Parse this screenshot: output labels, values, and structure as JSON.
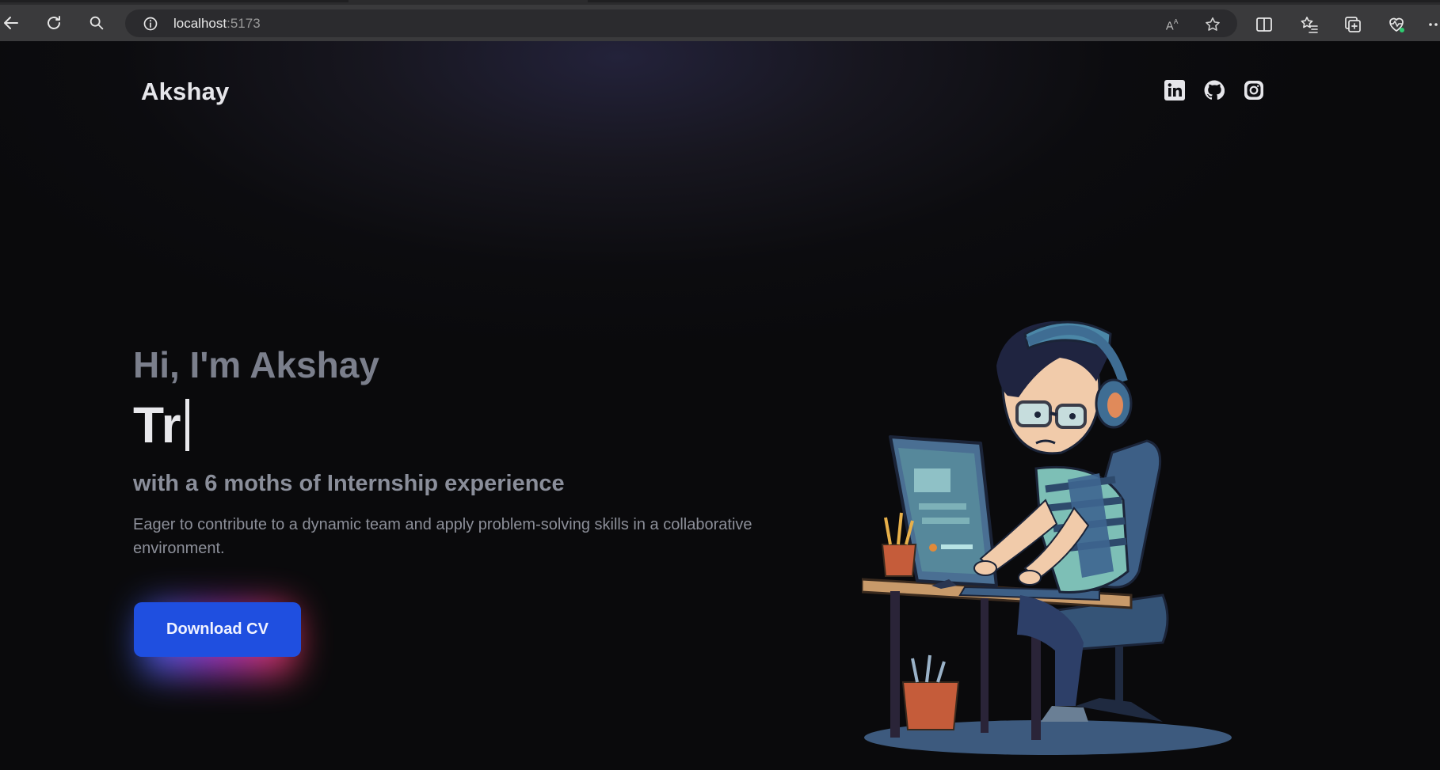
{
  "browser": {
    "url_host": "localhost",
    "url_port": ":5173"
  },
  "icons": {
    "back": "back-arrow-icon",
    "reload": "reload-icon",
    "search": "search-icon",
    "info": "info-icon",
    "read_aloud": "read-aloud-icon",
    "favorite": "star-icon",
    "split_screen": "split-screen-icon",
    "favorites": "favorites-icon",
    "collections": "collections-icon",
    "performance": "heartbeat-icon",
    "more": "more-icon",
    "linkedin": "linkedin-icon",
    "github": "github-icon",
    "instagram": "instagram-icon"
  },
  "header": {
    "brand": "Akshay"
  },
  "hero": {
    "greeting": "Hi, I'm Akshay",
    "typed_text": "Tr",
    "subtitle": "with a 6 moths of Internship experience",
    "description": "Eager to contribute to a dynamic team and apply problem-solving skills in a collaborative environment.",
    "cta_label": "Download CV"
  },
  "colors": {
    "background": "#0a0a0c",
    "cta": "#1f4fe0",
    "greeting": "#7b7f8c",
    "typed": "#e8e8ec"
  }
}
